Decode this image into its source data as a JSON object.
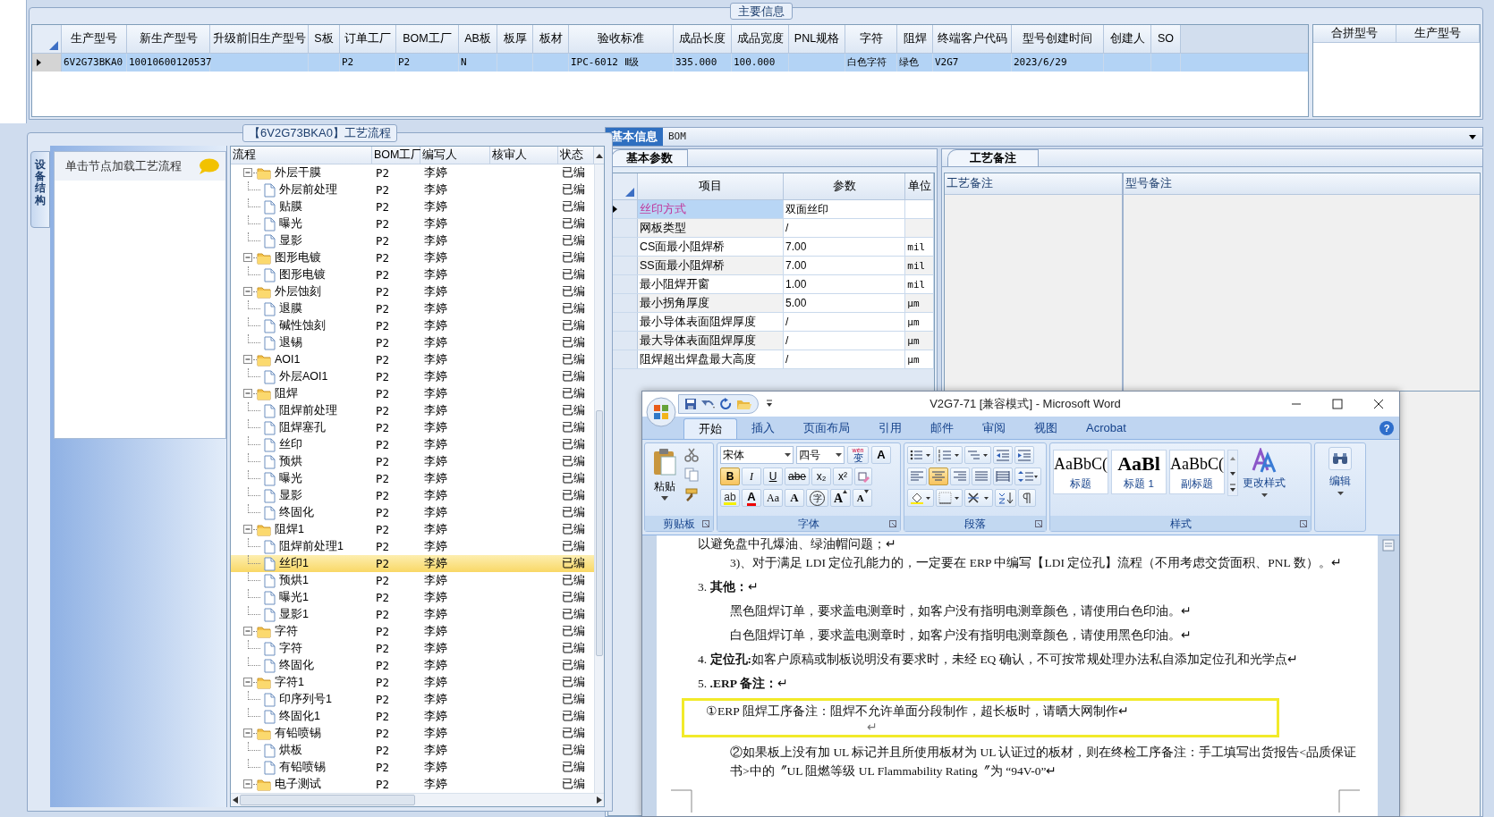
{
  "main_info": {
    "title": "主要信息",
    "columns": [
      "生产型号",
      "新生产型号",
      "升级前旧生产型号",
      "S板",
      "订单工厂",
      "BOM工厂",
      "AB板",
      "板厚",
      "板材",
      "验收标准",
      "成品长度",
      "成品宽度",
      "PNL规格",
      "字符",
      "阻焊",
      "终端客户代码",
      "型号创建时间",
      "创建人",
      "SO"
    ],
    "rows": [
      {
        "selected": true,
        "cells": [
          "6V2G73BKA0",
          "10010600120537",
          null,
          null,
          "P2",
          "P2",
          "N",
          null,
          null,
          "IPC-6012 Ⅱ级",
          "335.000",
          "100.000",
          null,
          "白色字符",
          "绿色",
          "V2G7",
          "2023/6/29",
          null,
          null
        ]
      }
    ]
  },
  "merge_table": {
    "columns": [
      "合拼型号",
      "生产型号"
    ]
  },
  "process_panel": {
    "title": "【6V2G73BKA0】工艺流程",
    "side_tab": "设备结构",
    "hint": "单击节点加载工艺流程",
    "columns": [
      "流程",
      "BOM工厂",
      "编写人",
      "核审人",
      "状态"
    ],
    "tree": [
      {
        "label": "外层干膜",
        "factory": "P2",
        "author": "李婷",
        "status": "已编",
        "selected": false,
        "expanded": true,
        "children": [
          {
            "label": "外层前处理",
            "factory": "P2",
            "author": "李婷",
            "status": "已编",
            "selected": false
          },
          {
            "label": "贴膜",
            "factory": "P2",
            "author": "李婷",
            "status": "已编",
            "selected": false
          },
          {
            "label": "曝光",
            "factory": "P2",
            "author": "李婷",
            "status": "已编",
            "selected": false
          },
          {
            "label": "显影",
            "factory": "P2",
            "author": "李婷",
            "status": "已编",
            "selected": false
          }
        ]
      },
      {
        "label": "图形电镀",
        "factory": "P2",
        "author": "李婷",
        "status": "已编",
        "selected": false,
        "expanded": true,
        "children": [
          {
            "label": "图形电镀",
            "factory": "P2",
            "author": "李婷",
            "status": "已编",
            "selected": false
          }
        ]
      },
      {
        "label": "外层蚀刻",
        "factory": "P2",
        "author": "李婷",
        "status": "已编",
        "selected": false,
        "expanded": true,
        "children": [
          {
            "label": "退膜",
            "factory": "P2",
            "author": "李婷",
            "status": "已编",
            "selected": false
          },
          {
            "label": "碱性蚀刻",
            "factory": "P2",
            "author": "李婷",
            "status": "已编",
            "selected": false
          },
          {
            "label": "退锡",
            "factory": "P2",
            "author": "李婷",
            "status": "已编",
            "selected": false
          }
        ]
      },
      {
        "label": "AOI1",
        "factory": "P2",
        "author": "李婷",
        "status": "已编",
        "selected": false,
        "expanded": true,
        "children": [
          {
            "label": "外层AOI1",
            "factory": "P2",
            "author": "李婷",
            "status": "已编",
            "selected": false
          }
        ]
      },
      {
        "label": "阻焊",
        "factory": "P2",
        "author": "李婷",
        "status": "已编",
        "selected": false,
        "expanded": true,
        "children": [
          {
            "label": "阻焊前处理",
            "factory": "P2",
            "author": "李婷",
            "status": "已编",
            "selected": false
          },
          {
            "label": "阻焊塞孔",
            "factory": "P2",
            "author": "李婷",
            "status": "已编",
            "selected": false
          },
          {
            "label": "丝印",
            "factory": "P2",
            "author": "李婷",
            "status": "已编",
            "selected": false
          },
          {
            "label": "预烘",
            "factory": "P2",
            "author": "李婷",
            "status": "已编",
            "selected": false
          },
          {
            "label": "曝光",
            "factory": "P2",
            "author": "李婷",
            "status": "已编",
            "selected": false
          },
          {
            "label": "显影",
            "factory": "P2",
            "author": "李婷",
            "status": "已编",
            "selected": false
          },
          {
            "label": "终固化",
            "factory": "P2",
            "author": "李婷",
            "status": "已编",
            "selected": false
          }
        ]
      },
      {
        "label": "阻焊1",
        "factory": "P2",
        "author": "李婷",
        "status": "已编",
        "selected": false,
        "expanded": true,
        "children": [
          {
            "label": "阻焊前处理1",
            "factory": "P2",
            "author": "李婷",
            "status": "已编",
            "selected": false
          },
          {
            "label": "丝印1",
            "factory": "P2",
            "author": "李婷",
            "status": "已编",
            "selected": true
          },
          {
            "label": "预烘1",
            "factory": "P2",
            "author": "李婷",
            "status": "已编",
            "selected": false
          },
          {
            "label": "曝光1",
            "factory": "P2",
            "author": "李婷",
            "status": "已编",
            "selected": false
          },
          {
            "label": "显影1",
            "factory": "P2",
            "author": "李婷",
            "status": "已编",
            "selected": false
          }
        ]
      },
      {
        "label": "字符",
        "factory": "P2",
        "author": "李婷",
        "status": "已编",
        "selected": false,
        "expanded": true,
        "children": [
          {
            "label": "字符",
            "factory": "P2",
            "author": "李婷",
            "status": "已编",
            "selected": false
          },
          {
            "label": "终固化",
            "factory": "P2",
            "author": "李婷",
            "status": "已编",
            "selected": false
          }
        ]
      },
      {
        "label": "字符1",
        "factory": "P2",
        "author": "李婷",
        "status": "已编",
        "selected": false,
        "expanded": true,
        "children": [
          {
            "label": "印序列号1",
            "factory": "P2",
            "author": "李婷",
            "status": "已编",
            "selected": false
          },
          {
            "label": "终固化1",
            "factory": "P2",
            "author": "李婷",
            "status": "已编",
            "selected": false
          }
        ]
      },
      {
        "label": "有铅喷锡",
        "factory": "P2",
        "author": "李婷",
        "status": "已编",
        "selected": false,
        "expanded": true,
        "children": [
          {
            "label": "烘板",
            "factory": "P2",
            "author": "李婷",
            "status": "已编",
            "selected": false
          },
          {
            "label": "有铅喷锡",
            "factory": "P2",
            "author": "李婷",
            "status": "已编",
            "selected": false
          }
        ]
      },
      {
        "label": "电子测试",
        "factory": "P2",
        "author": "李婷",
        "status": "已编",
        "selected": false,
        "expanded": true
      }
    ]
  },
  "detail_tabs": [
    {
      "label": "基本信息",
      "selected": true
    },
    {
      "label": "BOM",
      "selected": false
    }
  ],
  "params": {
    "tab": "基本参数",
    "columns": [
      "项目",
      "参数",
      "单位"
    ],
    "rows": [
      {
        "item": "丝印方式",
        "value": "双面丝印",
        "selected": true
      },
      {
        "item": "网板类型",
        "value": "/",
        "selected": false
      },
      {
        "item": "CS面最小阻焊桥",
        "value": "7.00",
        "unit": "mil",
        "selected": false
      },
      {
        "item": "SS面最小阻焊桥",
        "value": "7.00",
        "unit": "mil",
        "selected": false
      },
      {
        "item": "最小阻焊开窗",
        "value": "1.00",
        "unit": "mil",
        "selected": false
      },
      {
        "item": "最小拐角厚度",
        "value": "5.00",
        "unit": "µm",
        "selected": false
      },
      {
        "item": "最小导体表面阻焊厚度",
        "value": "/",
        "unit": "µm",
        "selected": false
      },
      {
        "item": "最大导体表面阻焊厚度",
        "value": "/",
        "unit": "µm",
        "selected": false
      },
      {
        "item": "阻焊超出焊盘最大高度",
        "value": "/",
        "unit": "µm",
        "selected": false
      }
    ]
  },
  "notes": {
    "tab": "工艺备注",
    "columns": [
      "工艺备注",
      "型号备注"
    ]
  },
  "word": {
    "title": "V2G7-71 [兼容模式] - Microsoft Word",
    "tabs": [
      {
        "label": "开始",
        "selected": true
      },
      {
        "label": "插入",
        "selected": false
      },
      {
        "label": "页面布局",
        "selected": false
      },
      {
        "label": "引用",
        "selected": false
      },
      {
        "label": "邮件",
        "selected": false
      },
      {
        "label": "审阅",
        "selected": false
      },
      {
        "label": "视图",
        "selected": false
      },
      {
        "label": "Acrobat",
        "selected": false
      }
    ],
    "help": "?",
    "ribbon": {
      "clipboard": {
        "paste": "粘贴",
        "label": "剪贴板"
      },
      "font": {
        "label": "字体",
        "name": "宋体",
        "size": "四号",
        "phonetic": {
          "ruby": "wén",
          "text": "变"
        },
        "border_char": "A",
        "format": [
          {
            "text": "B",
            "kind": "bold",
            "on": true
          },
          {
            "text": "I",
            "kind": "italic",
            "on": false
          },
          {
            "text": "U",
            "kind": "underline",
            "on": false
          },
          {
            "text": "abe",
            "kind": "strike",
            "on": false
          },
          {
            "text": "x₂",
            "kind": "sub",
            "on": false
          },
          {
            "text": "x²",
            "kind": "sup",
            "on": false
          }
        ],
        "effects": [
          {
            "text": "ab",
            "kind": "highlight"
          },
          {
            "text": "A",
            "kind": "color"
          },
          {
            "text": "Aa",
            "kind": "case"
          },
          {
            "text": "A",
            "kind": "shade"
          },
          {
            "text": "字",
            "kind": "enclose"
          },
          {
            "text": "A",
            "kind": "grow"
          },
          {
            "text": "A",
            "kind": "shrink"
          }
        ]
      },
      "paragraph": {
        "label": "段落",
        "align": [
          {
            "kind": "left",
            "on": false
          },
          {
            "kind": "center",
            "on": true
          },
          {
            "kind": "right",
            "on": false
          },
          {
            "kind": "justify",
            "on": false
          },
          {
            "kind": "distribute",
            "on": false
          }
        ]
      },
      "styles": {
        "label": "样式",
        "items": [
          {
            "sample": "AaBbC(",
            "name": "标题"
          },
          {
            "sample": "AaBl",
            "name": "标题 1"
          },
          {
            "sample": "AaBbC(",
            "name": "副标题"
          }
        ],
        "change": "更改样式"
      },
      "editing": {
        "label": "编辑"
      }
    },
    "document": [
      {
        "kind": "plain",
        "text": "以避免盘中孔爆油、绿油帽问题；↵"
      },
      {
        "kind": "indent",
        "text": "3)、对于满足 LDI 定位孔能力的，一定要在 ERP 中编写【LDI 定位孔】流程（不用考虑交货面积、PNL 数）。↵"
      },
      {
        "kind": "heading",
        "text": "3. **其他：**↵"
      },
      {
        "kind": "indent",
        "text": "黑色阻焊订单，要求盖电测章时，如客户没有指明电测章颜色，请使用白色印油。↵"
      },
      {
        "kind": "indent",
        "text": "白色阻焊订单，要求盖电测章时，如客户没有指明电测章颜色，请使用黑色印油。↵"
      },
      {
        "kind": "heading",
        "text": "4. **定位孔:**如客户原稿或制板说明没有要求时，未经 EQ 确认，不可按常规处理办法私自添加定位孔和光学点↵"
      },
      {
        "kind": "heading",
        "text": "5. **.ERP 备注：**↵"
      },
      {
        "kind": "boxed",
        "text": "①ERP 阻焊工序备注：阻焊不允许单面分段制作，超长板时，请晒大网制作↵",
        "after": "↵"
      },
      {
        "kind": "indent",
        "text": "②如果板上没有加 UL 标记并且所使用板材为 UL 认证过的板材，则在终检工序备注：手工填写出货报告<品质保证书>中的〞UL 阻燃等级 UL Flammability Rating〞为 “94V-0”↵"
      }
    ]
  }
}
